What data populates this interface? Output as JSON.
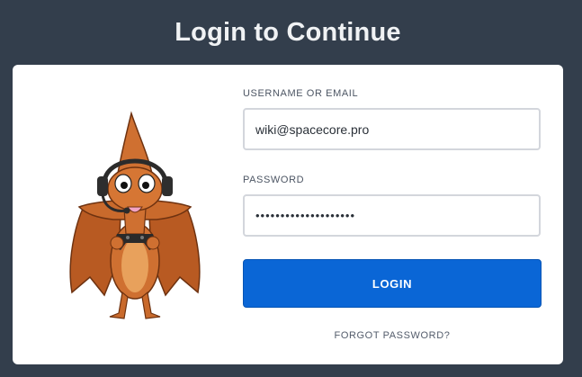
{
  "header": {
    "title": "Login to Continue"
  },
  "form": {
    "username_label": "USERNAME OR EMAIL",
    "username_value": "wiki@spacecore.pro",
    "password_label": "PASSWORD",
    "password_value": "••••••••••••••••••••",
    "login_label": "LOGIN",
    "forgot_label": "FORGOT PASSWORD?"
  },
  "mascot": {
    "icon": "pterodactyl-gamer-mascot"
  },
  "colors": {
    "background": "#333e4c",
    "card": "#ffffff",
    "primary_button": "#0a66d6",
    "input_border": "#d3d6dc",
    "mascot_body": "#c8642a"
  }
}
